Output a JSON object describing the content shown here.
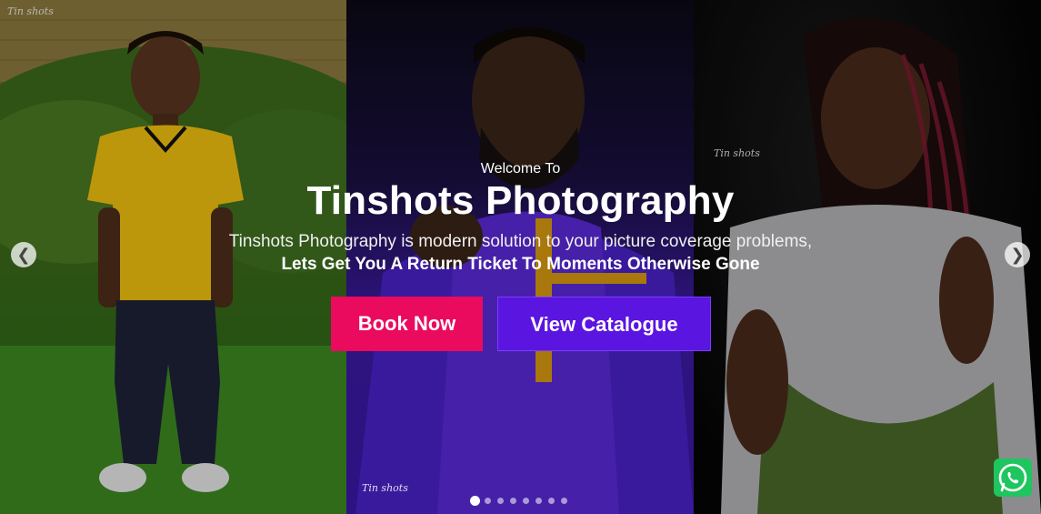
{
  "hero": {
    "welcome": "Welcome To",
    "title": "Tinshots Photography",
    "description_plain": "Tinshots Photography is modern solution to your picture coverage problems,",
    "description_bold": "Lets Get You A Return Ticket To Moments Otherwise Gone",
    "book_label": "Book Now",
    "catalogue_label": "View Catalogue"
  },
  "carousel": {
    "prev_icon": "chevron-left-icon",
    "next_icon": "chevron-right-icon",
    "slide_count": 8,
    "active_index": 0
  },
  "whatsapp": {
    "icon": "whatsapp-icon",
    "color": "#1fc55e"
  },
  "colors": {
    "book_button": "#ea0a5e",
    "catalogue_button": "#5b15e0"
  }
}
